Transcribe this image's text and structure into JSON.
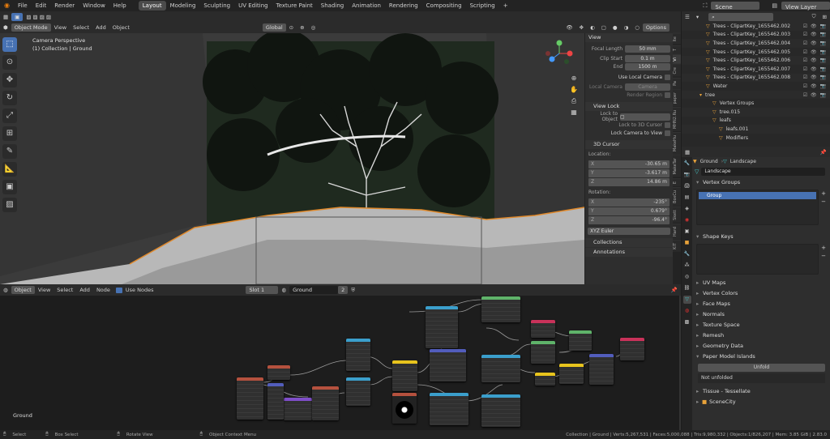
{
  "menu": [
    "File",
    "Edit",
    "Render",
    "Window",
    "Help"
  ],
  "workspaces": [
    "Layout",
    "Modeling",
    "Sculpting",
    "UV Editing",
    "Texture Paint",
    "Shading",
    "Animation",
    "Rendering",
    "Compositing",
    "Scripting"
  ],
  "active_workspace": "Layout",
  "scene": {
    "label": "Scene",
    "view_layer": "View Layer"
  },
  "viewport_header": {
    "mode": "Object Mode",
    "menus": [
      "View",
      "Select",
      "Add",
      "Object"
    ],
    "orientation": "Global",
    "options": "Options"
  },
  "viewport": {
    "overlay_title": "Camera Perspective",
    "overlay_subtitle": "(1) Collection | Ground"
  },
  "npanel": {
    "view_header": "View",
    "focal_length": {
      "label": "Focal Length",
      "value": "50 mm"
    },
    "clip_start": {
      "label": "Clip Start",
      "value": "0.1 m"
    },
    "clip_end": {
      "label": "End",
      "value": "1500 m"
    },
    "use_local_camera": "Use Local Camera",
    "local_camera": {
      "label": "Local Camera",
      "value": "Camera"
    },
    "render_region": "Render Region",
    "view_lock_header": "View Lock",
    "lock_to_object": "Lock to Object",
    "lock_3d_cursor": "Lock to 3D Cursor",
    "lock_camera": "Lock Camera to View",
    "cursor_header": "3D Cursor",
    "location_label": "Location:",
    "loc": [
      {
        "axis": "X",
        "value": "-30.65 m"
      },
      {
        "axis": "Y",
        "value": "-3.617 m"
      },
      {
        "axis": "Z",
        "value": "14.86 m"
      }
    ],
    "rotation_label": "Rotation:",
    "rot": [
      {
        "axis": "X",
        "value": "-235°"
      },
      {
        "axis": "Y",
        "value": "0.679°"
      },
      {
        "axis": "Z",
        "value": "-96.4°"
      }
    ],
    "rot_mode": "XYZ Euler",
    "collections": "Collections",
    "annotations": "Annotations"
  },
  "side_tabs": [
    "Ite",
    "T",
    "Vi",
    "Cre",
    "Pa",
    "paper",
    "MHN2.Ru",
    "MakeHu",
    "MakeTar",
    "E",
    "BoxCu",
    "Skett",
    "Hard",
    "KIT"
  ],
  "outliner": {
    "items": [
      {
        "name": "Trees - ClipartKey_1655462.002",
        "indent": 0
      },
      {
        "name": "Trees - ClipartKey_1655462.003",
        "indent": 0
      },
      {
        "name": "Trees - ClipartKey_1655462.004",
        "indent": 0
      },
      {
        "name": "Trees - ClipartKey_1655462.005",
        "indent": 0
      },
      {
        "name": "Trees - ClipartKey_1655462.006",
        "indent": 0
      },
      {
        "name": "Trees - ClipartKey_1655462.007",
        "indent": 0
      },
      {
        "name": "Trees - ClipartKey_1655462.008",
        "indent": 0
      },
      {
        "name": "Water",
        "indent": 0
      },
      {
        "name": "tree",
        "indent": -1
      },
      {
        "name": "Vertex Groups",
        "indent": 1
      },
      {
        "name": "tree.015",
        "indent": 1
      },
      {
        "name": "leafs",
        "indent": 1
      },
      {
        "name": "leafs.001",
        "indent": 2
      },
      {
        "name": "Modifiers",
        "indent": 2
      }
    ]
  },
  "properties": {
    "breadcrumb_object": "Ground",
    "breadcrumb_data": "Landscape",
    "data_name": "Landscape",
    "vertex_groups": "Vertex Groups",
    "group_item": "Group",
    "shape_keys": "Shape Keys",
    "sections": [
      "UV Maps",
      "Vertex Colors",
      "Face Maps",
      "Normals",
      "Texture Space",
      "Remesh",
      "Geometry Data",
      "Paper Model Islands"
    ],
    "unfold_button": "Unfold",
    "not_unfolded": "Not unfolded",
    "tissue": "Tissue - Tessellate",
    "scenecity": "SceneCity"
  },
  "node_header": {
    "object": "Object",
    "menus": [
      "View",
      "Select",
      "Add",
      "Node"
    ],
    "use_nodes": "Use Nodes",
    "slot": "Slot 1",
    "material": "Ground",
    "users": "2"
  },
  "node_editor": {
    "material_label": "Ground"
  },
  "status": {
    "select": "Select",
    "box_select": "Box Select",
    "rotate": "Rotate View",
    "context": "Object Context Menu",
    "stats": "Collection | Ground | Verts:5,267,531 | Faces:5,000,088 | Tris:9,980,332 | Objects:1/826,207 | Mem: 3.85 GiB | 2.83.0"
  }
}
